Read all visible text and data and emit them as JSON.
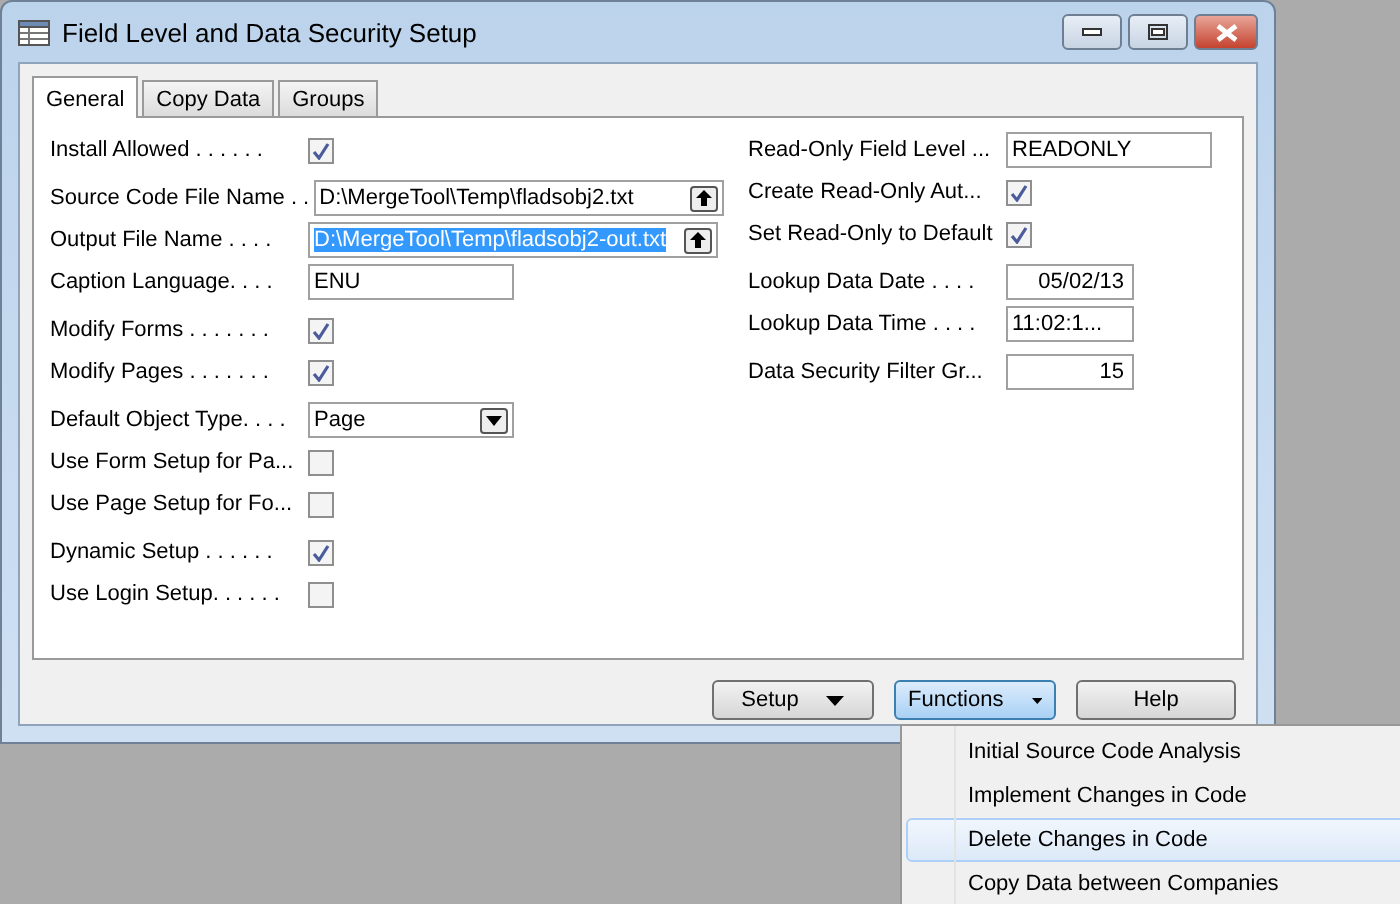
{
  "window": {
    "title": "Field Level and Data Security Setup"
  },
  "tabs": [
    {
      "label": "General",
      "selected": true
    },
    {
      "label": "Copy Data",
      "selected": false
    },
    {
      "label": "Groups",
      "selected": false
    }
  ],
  "left_groups": [
    [
      {
        "label": "Install Allowed . . . . . .",
        "kind": "checkbox",
        "checked": true
      }
    ],
    [
      {
        "label": "Source Code File Name  . .",
        "kind": "lookup",
        "value": "D:\\MergeTool\\Temp\\fladsobj2.txt",
        "selected": false
      },
      {
        "label": "Output File Name  . . . .",
        "kind": "lookup",
        "value": "D:\\MergeTool\\Temp\\fladsobj2-out.txt",
        "selected": true
      },
      {
        "label": "Caption Language. . . .",
        "kind": "text",
        "value": "ENU"
      }
    ],
    [
      {
        "label": "Modify Forms . . . . . . .",
        "kind": "checkbox",
        "checked": true
      },
      {
        "label": "Modify Pages . . . . . . .",
        "kind": "checkbox",
        "checked": true
      }
    ],
    [
      {
        "label": "Default Object Type. . . .",
        "kind": "dropdown",
        "value": "Page"
      },
      {
        "label": "Use Form Setup for Pa...",
        "kind": "checkbox",
        "checked": false
      },
      {
        "label": "Use Page Setup for Fo...",
        "kind": "checkbox",
        "checked": false
      }
    ],
    [
      {
        "label": "Dynamic Setup  . . . . . .",
        "kind": "checkbox",
        "checked": true
      },
      {
        "label": "Use Login Setup. . . . . .",
        "kind": "checkbox",
        "checked": false
      }
    ]
  ],
  "right_groups": [
    [
      {
        "label": "Read-Only Field Level ...",
        "kind": "text",
        "value": "READONLY"
      },
      {
        "label": "Create Read-Only Aut...",
        "kind": "checkbox",
        "checked": true
      },
      {
        "label": "Set Read-Only to Default",
        "kind": "checkbox",
        "checked": true
      }
    ],
    [
      {
        "label": "Lookup Data Date . . . .",
        "kind": "number",
        "value": "05/02/13"
      },
      {
        "label": "Lookup Data Time . . . .",
        "kind": "short",
        "value": "11:02:1..."
      }
    ],
    [
      {
        "label": "Data Security Filter Gr...",
        "kind": "number",
        "value": "15"
      }
    ]
  ],
  "buttons": [
    {
      "label": "Setup",
      "kind": "menu",
      "pressed": false
    },
    {
      "label": "Functions",
      "kind": "menu",
      "pressed": true
    },
    {
      "label": "Help",
      "kind": "plain",
      "pressed": false
    }
  ],
  "menu": {
    "items": [
      {
        "label": "Initial Source Code Analysis",
        "selected": false
      },
      {
        "label": "Implement Changes in Code",
        "selected": false
      },
      {
        "label": "Delete Changes in Code",
        "selected": true
      },
      {
        "label": "Copy Data between Companies",
        "selected": false
      }
    ]
  }
}
